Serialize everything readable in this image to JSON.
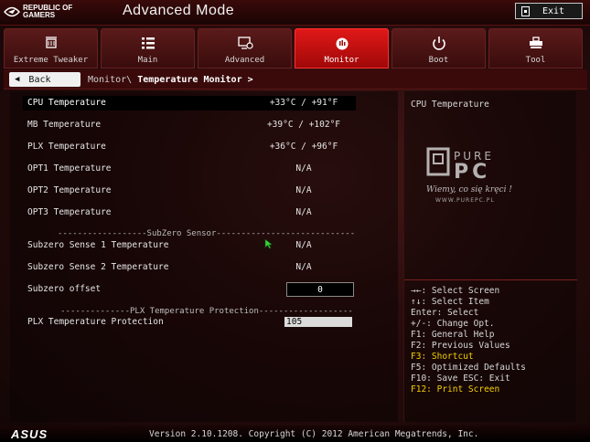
{
  "header": {
    "brand_line1": "REPUBLIC OF",
    "brand_line2": "GAMERS",
    "title": "Advanced Mode",
    "exit_label": "Exit"
  },
  "tabs": [
    {
      "label": "Extreme Tweaker",
      "icon": "extreme-tweaker-icon"
    },
    {
      "label": "Main",
      "icon": "list-icon"
    },
    {
      "label": "Advanced",
      "icon": "advanced-icon"
    },
    {
      "label": "Monitor",
      "icon": "monitor-icon",
      "active": true
    },
    {
      "label": "Boot",
      "icon": "power-icon"
    },
    {
      "label": "Tool",
      "icon": "tool-icon"
    }
  ],
  "nav": {
    "back_label": "Back",
    "crumb_parent": "Monitor\\",
    "crumb_current": "Temperature Monitor >"
  },
  "rows": [
    {
      "label": "CPU Temperature",
      "value": "+33°C / +91°F"
    },
    {
      "label": "MB Temperature",
      "value": "+39°C / +102°F"
    },
    {
      "label": "PLX Temperature",
      "value": "+36°C / +96°F"
    },
    {
      "label": "OPT1 Temperature",
      "value": "N/A"
    },
    {
      "label": "OPT2 Temperature",
      "value": "N/A"
    },
    {
      "label": "OPT3 Temperature",
      "value": "N/A"
    },
    {
      "label": "Subzero Sense 1 Temperature",
      "value": "N/A"
    },
    {
      "label": "Subzero Sense 2 Temperature",
      "value": "N/A"
    },
    {
      "label": "Subzero offset",
      "value": "0"
    },
    {
      "label": "PLX Temperature Protection",
      "value": "105"
    }
  ],
  "separators": {
    "subzero": "------------------SubZero Sensor--------------------------------------",
    "plx": "--------------PLX Temperature Protection-------------------"
  },
  "help": {
    "title": "CPU Temperature",
    "watermark_text1": "PURE",
    "watermark_text2": "PC",
    "watermark_tagline": "Wiemy, co się kręci !",
    "watermark_url": "WWW.PUREPC.PL",
    "keys": [
      {
        "text": "→←: Select Screen",
        "hl": false
      },
      {
        "text": "↑↓: Select Item",
        "hl": false
      },
      {
        "text": "Enter: Select",
        "hl": false
      },
      {
        "text": "+/-: Change Opt.",
        "hl": false
      },
      {
        "text": "F1: General Help",
        "hl": false
      },
      {
        "text": "F2: Previous Values",
        "hl": false
      },
      {
        "text": "F3: Shortcut",
        "hl": true
      },
      {
        "text": "F5: Optimized Defaults",
        "hl": false
      },
      {
        "text": "F10: Save  ESC: Exit",
        "hl": false
      },
      {
        "text": "F12: Print Screen",
        "hl": true
      }
    ]
  },
  "footer": {
    "brand": "ASUS",
    "version": "Version 2.10.1208. Copyright (C) 2012 American Megatrends, Inc."
  },
  "colors": {
    "accent": "#e01818",
    "highlight": "#f4d000"
  }
}
